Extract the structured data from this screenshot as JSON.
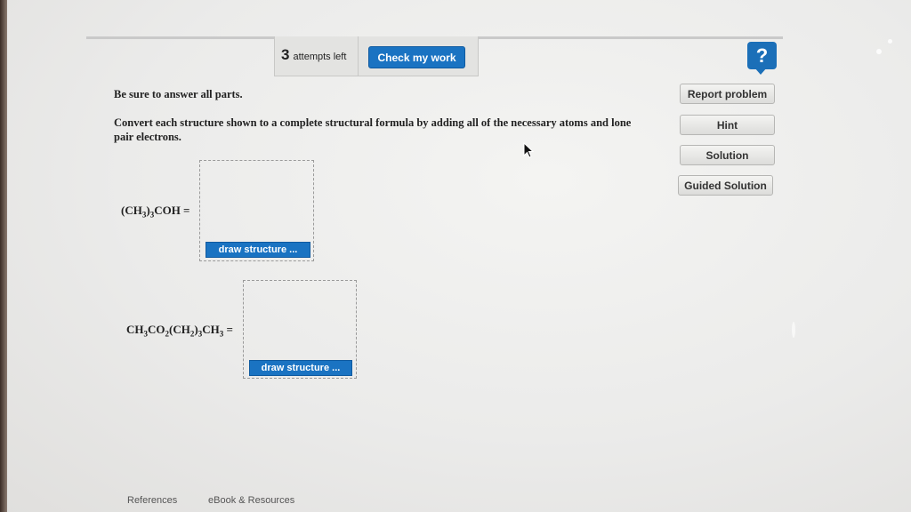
{
  "header": {
    "attempts_count": "3",
    "attempts_label": "attempts left",
    "check_button": "Check my work",
    "help_label": "?"
  },
  "side_buttons": {
    "report": "Report problem",
    "hint": "Hint",
    "solution": "Solution",
    "guided": "Guided Solution"
  },
  "question": {
    "instruction_1": "Be sure to answer all parts.",
    "instruction_2": "Convert each structure shown to a complete structural formula by adding all of the necessary atoms and lone pair electrons.",
    "parts": [
      {
        "formula": "(CH3)3COH =",
        "button": "draw structure ..."
      },
      {
        "formula": "CH3CO2(CH2)3CH3 =",
        "button": "draw structure ..."
      }
    ]
  },
  "footer": {
    "references": "References",
    "ebook": "eBook & Resources"
  },
  "colors": {
    "accent_blue": "#1a73c2",
    "help_blue": "#1b6fb8"
  }
}
